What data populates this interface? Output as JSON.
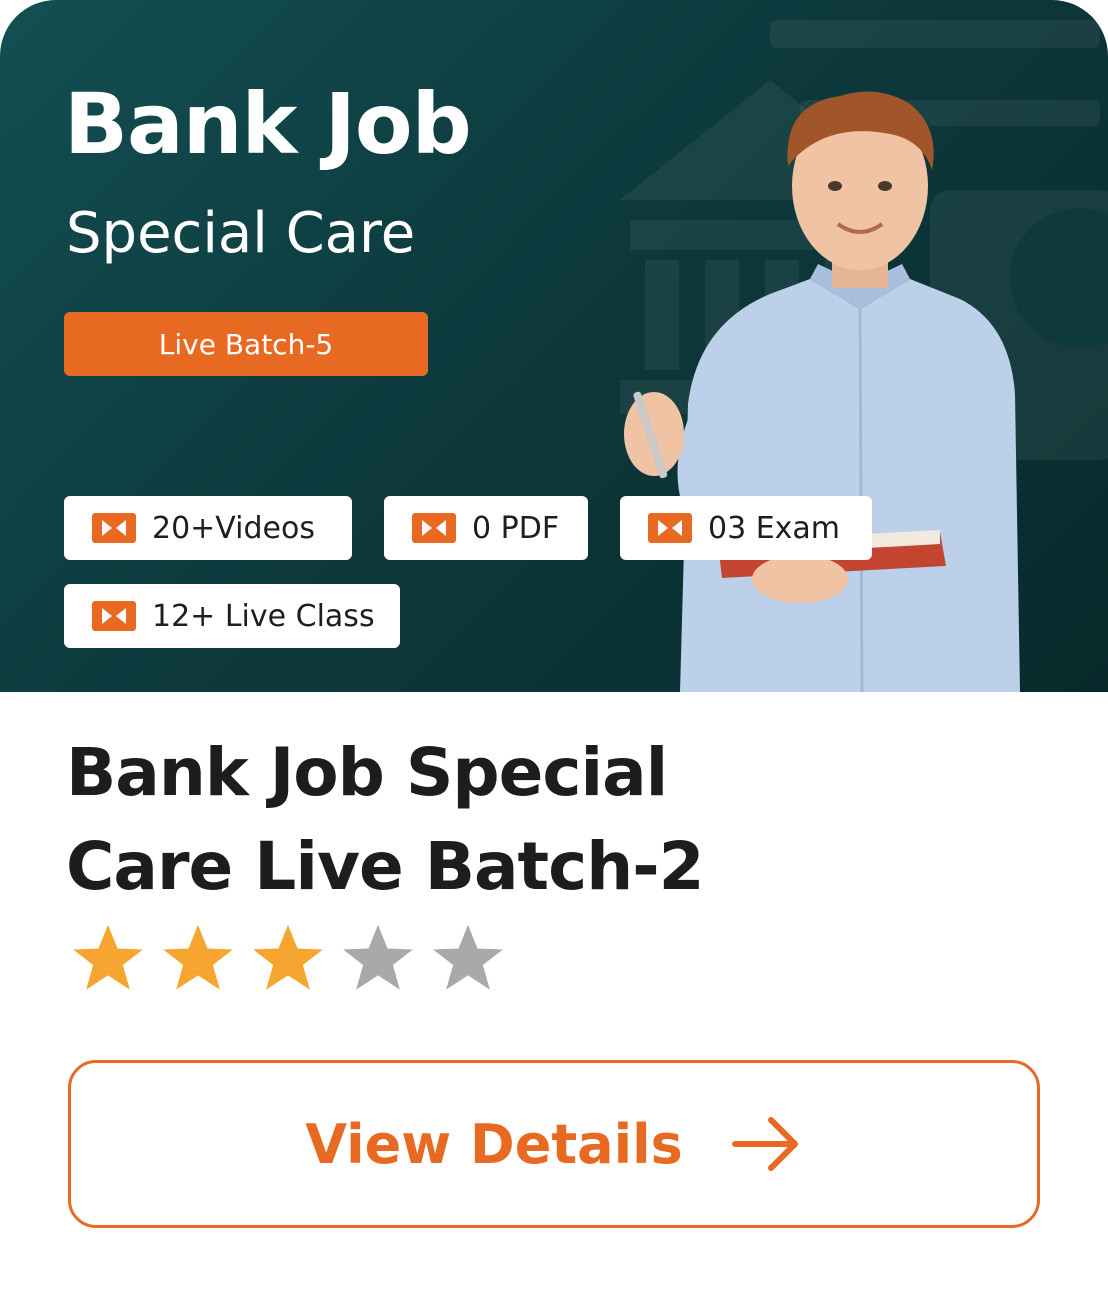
{
  "banner": {
    "title": "Bank Job",
    "subtitle": "Special Care",
    "badge": "Live Batch-5",
    "features": [
      {
        "icon": "video-icon",
        "label": "20+Videos"
      },
      {
        "icon": "video-icon",
        "label": "0 PDF"
      },
      {
        "icon": "video-icon",
        "label": "03 Exam"
      },
      {
        "icon": "video-icon",
        "label": "12+ Live Class"
      }
    ]
  },
  "course": {
    "title": "Bank Job Special Care Live Batch-2",
    "rating": 3,
    "rating_max": 5
  },
  "cta": {
    "label": "View Details",
    "icon": "arrow-right-icon"
  },
  "colors": {
    "accent": "#e86a22",
    "banner_dark": "#0d3a3d",
    "star_filled": "#f6a531",
    "star_empty": "#a9a9a9"
  }
}
